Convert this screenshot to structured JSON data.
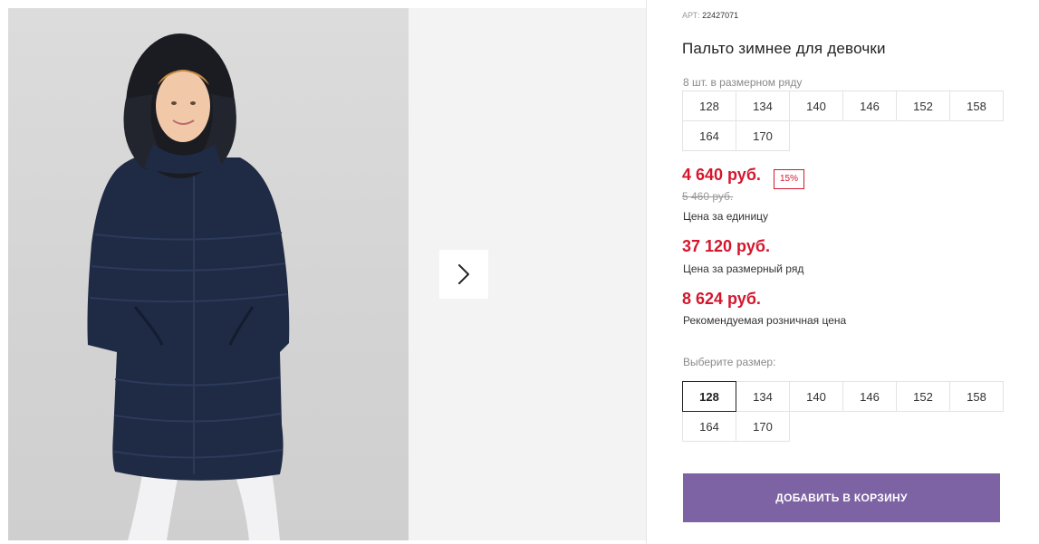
{
  "product": {
    "sku_label": "АРТ:",
    "sku": "22427071",
    "title": "Пальто зимнее для девочки",
    "pack_note": "8 шт. в размерном ряду",
    "pack_sizes": [
      "128",
      "134",
      "140",
      "146",
      "152",
      "158",
      "164",
      "170"
    ],
    "price_unit": "4 640 руб.",
    "discount": "15%",
    "price_old": "5 460 руб.",
    "price_unit_label": "Цена за единицу",
    "price_row": "37 120 руб.",
    "price_row_label": "Цена за размерный ряд",
    "price_retail": "8 624 руб.",
    "price_retail_label": "Рекомендуемая розничная цена",
    "choose_size_label": "Выберите размер:",
    "sizes": [
      "128",
      "134",
      "140",
      "146",
      "152",
      "158",
      "164",
      "170"
    ],
    "selected_size": "128",
    "add_to_cart_label": "ДОБАВИТЬ В КОРЗИНУ"
  },
  "gallery": {
    "next_icon": "chevron-right-icon",
    "image_subject": "product-photo"
  },
  "colors": {
    "price_red": "#d4162d",
    "button_purple": "#7d63a4",
    "coat_navy": "#1f2a44"
  }
}
